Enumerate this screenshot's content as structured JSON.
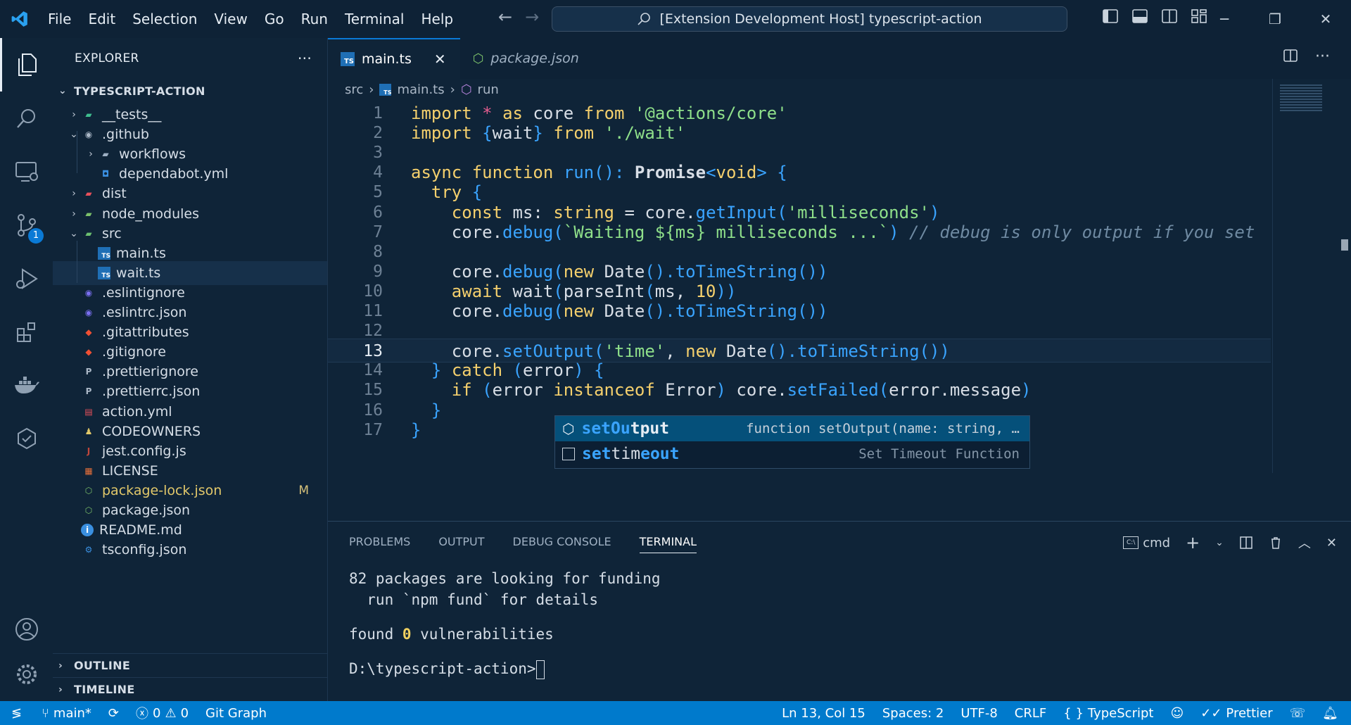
{
  "titlebar": {
    "menu": [
      "File",
      "Edit",
      "Selection",
      "View",
      "Go",
      "Run",
      "Terminal",
      "Help"
    ],
    "command_center": "[Extension Development Host] typescript-action"
  },
  "activity": {
    "scm_badge": "1"
  },
  "sidebar": {
    "title": "EXPLORER",
    "more": "···",
    "root": "TYPESCRIPT-ACTION",
    "items": [
      {
        "label": "__tests__",
        "depth": 1,
        "twist": "›",
        "icon": "folder-tests-icon"
      },
      {
        "label": ".github",
        "depth": 1,
        "twist": "⌄",
        "icon": "folder-github-icon"
      },
      {
        "label": "workflows",
        "depth": 2,
        "twist": "›",
        "icon": "folder-icon"
      },
      {
        "label": "dependabot.yml",
        "depth": 2,
        "twist": "",
        "icon": "dependabot-icon"
      },
      {
        "label": "dist",
        "depth": 1,
        "twist": "›",
        "icon": "folder-dist-icon"
      },
      {
        "label": "node_modules",
        "depth": 1,
        "twist": "›",
        "icon": "folder-node-icon"
      },
      {
        "label": "src",
        "depth": 1,
        "twist": "⌄",
        "icon": "folder-src-icon"
      },
      {
        "label": "main.ts",
        "depth": 2,
        "twist": "",
        "icon": "typescript-file-icon"
      },
      {
        "label": "wait.ts",
        "depth": 2,
        "twist": "",
        "icon": "typescript-file-icon",
        "selected": true
      },
      {
        "label": ".eslintignore",
        "depth": 1,
        "twist": "",
        "icon": "eslint-icon"
      },
      {
        "label": ".eslintrc.json",
        "depth": 1,
        "twist": "",
        "icon": "eslint-icon"
      },
      {
        "label": ".gitattributes",
        "depth": 1,
        "twist": "",
        "icon": "git-icon"
      },
      {
        "label": ".gitignore",
        "depth": 1,
        "twist": "",
        "icon": "git-icon"
      },
      {
        "label": ".prettierignore",
        "depth": 1,
        "twist": "",
        "icon": "prettier-icon"
      },
      {
        "label": ".prettierrc.json",
        "depth": 1,
        "twist": "",
        "icon": "prettier-icon"
      },
      {
        "label": "action.yml",
        "depth": 1,
        "twist": "",
        "icon": "yaml-icon"
      },
      {
        "label": "CODEOWNERS",
        "depth": 1,
        "twist": "",
        "icon": "codeowners-icon"
      },
      {
        "label": "jest.config.js",
        "depth": 1,
        "twist": "",
        "icon": "jest-icon"
      },
      {
        "label": "LICENSE",
        "depth": 1,
        "twist": "",
        "icon": "license-icon"
      },
      {
        "label": "package-lock.json",
        "depth": 1,
        "twist": "",
        "icon": "nodejs-icon",
        "modified": true,
        "decoration": "M"
      },
      {
        "label": "package.json",
        "depth": 1,
        "twist": "",
        "icon": "nodejs-icon"
      },
      {
        "label": "README.md",
        "depth": 1,
        "twist": "",
        "icon": "info-icon"
      },
      {
        "label": "tsconfig.json",
        "depth": 1,
        "twist": "",
        "icon": "tsconfig-icon"
      }
    ],
    "outline": "OUTLINE",
    "timeline": "TIMELINE"
  },
  "editor": {
    "tabs": [
      {
        "label": "main.ts",
        "active": true,
        "close": "✕"
      },
      {
        "label": "package.json",
        "active": false
      }
    ],
    "breadcrumb": [
      "src",
      "main.ts",
      "run"
    ],
    "current_line": 13,
    "code_lines": [
      "import * as core from '@actions/core'",
      "import {wait} from './wait'",
      "",
      "async function run(): Promise<void> {",
      "  try {",
      "    const ms: string = core.getInput('milliseconds')",
      "    core.debug(`Waiting ${ms} milliseconds ...`) // debug is only output if you set",
      "",
      "    core.debug(new Date().toTimeString())",
      "    await wait(parseInt(ms, 10))",
      "    core.debug(new Date().toTimeString())",
      "",
      "    core.setOutput('time', new Date().toTimeString())",
      "  } catch (error) {",
      "    if (error instanceof Error) core.setFailed(error.message)",
      "  }",
      "}"
    ],
    "line_numbers": [
      "1",
      "2",
      "3",
      "4",
      "5",
      "6",
      "7",
      "8",
      "9",
      "10",
      "11",
      "12",
      "13",
      "14",
      "15",
      "16",
      "17"
    ]
  },
  "suggest": [
    {
      "match": "setOu",
      "rest": "tput",
      "detail": "function setOutput(name: string, …",
      "selected": true,
      "icon": "method-icon"
    },
    {
      "match": "set",
      "mid": "tim",
      "match2": "eout",
      "detail": "Set Timeout Function",
      "selected": false,
      "icon": "snippet-icon"
    }
  ],
  "panel": {
    "tabs": [
      "PROBLEMS",
      "OUTPUT",
      "DEBUG CONSOLE",
      "TERMINAL"
    ],
    "active_tab": "TERMINAL",
    "shell": "cmd",
    "terminal_lines": [
      "82 packages are looking for funding",
      "  run `npm fund` for details",
      "",
      "found 0 vulnerabilities",
      "",
      "D:\\typescript-action>"
    ]
  },
  "statusbar": {
    "branch": "main*",
    "errors": "0",
    "warnings": "0",
    "git_graph": "Git Graph",
    "position": "Ln 13, Col 15",
    "spaces": "Spaces: 2",
    "encoding": "UTF-8",
    "eol": "CRLF",
    "language": "TypeScript",
    "prettier": "Prettier"
  },
  "colors": {
    "background": "#0f2438",
    "accent": "#007acc",
    "keyword": "#f5d06d",
    "string": "#8fe08a",
    "function": "#3aa4ff"
  }
}
